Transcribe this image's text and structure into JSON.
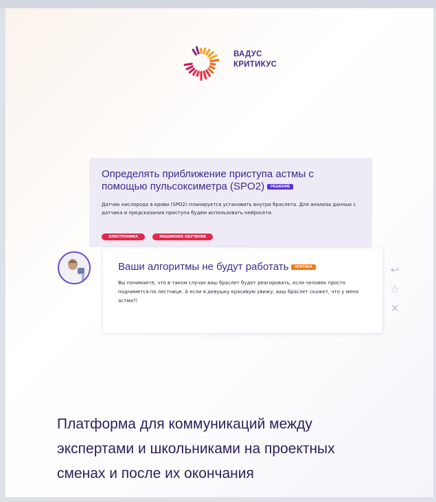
{
  "logo": {
    "line1": "ВАДУС",
    "line2": "КРИТИКУС",
    "colors": [
      "#f7a21b",
      "#f26a22",
      "#e8304a",
      "#c5215f",
      "#8a2a8c"
    ]
  },
  "solution_card": {
    "title": "Определять приближение приступа астмы с помощью пульсоксиметра (SPO2)",
    "badge": "решение",
    "body": "Датчик кислорода в крови (SPO2) планируется установить внутри браслета. Для анализа данных с датчика и предсказания приступа будем использовать нейросети.",
    "tags": [
      "электроника",
      "машинное обучение"
    ]
  },
  "critique_card": {
    "title": "Ваши алгоритмы не будут работать",
    "badge": "критика",
    "body": "Вы понимаете, что в таком случае ваш браслет будет реагировать, если человек просто поднимется по лестнице. А если я девушку красивую увижу, ваш браслет скажет, что у меня астма?!",
    "actions": [
      "reply-icon",
      "star-icon",
      "close-icon"
    ]
  },
  "tagline": {
    "line1": "Платформа для коммуникаций между",
    "line2": "экспертами и школьниками на проектных",
    "line3": "сменах и после их окончания"
  },
  "colors": {
    "accent_purple": "#3b2a8c",
    "solution_badge": "#5a33d6",
    "critique_badge": "#f07a1a",
    "tag_red": "#e2294b"
  }
}
